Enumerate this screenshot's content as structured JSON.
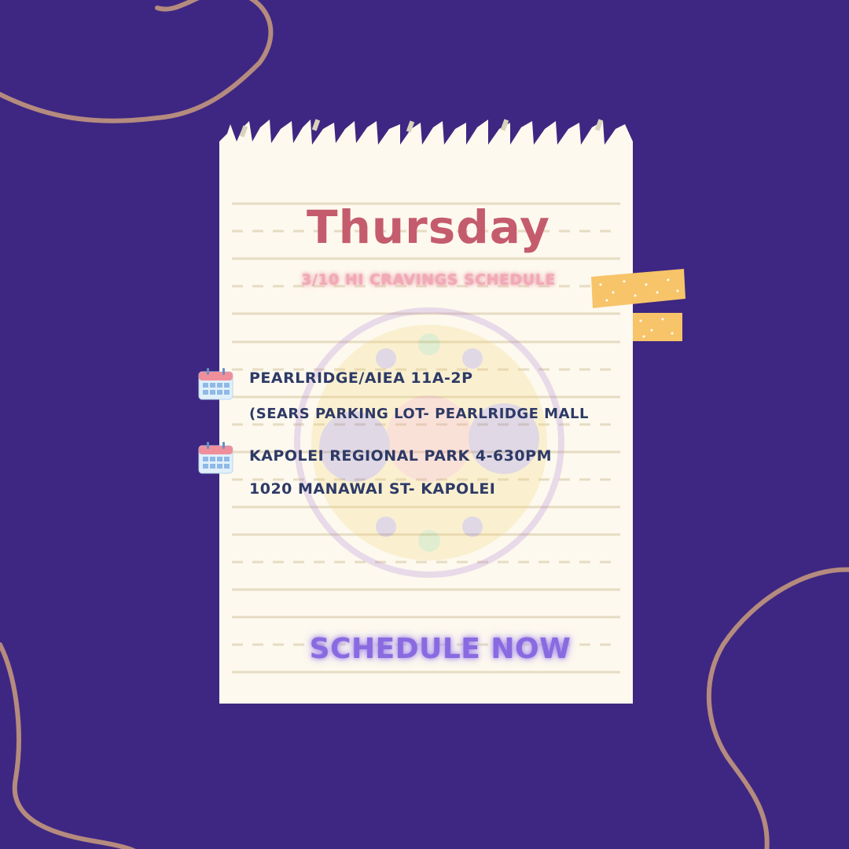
{
  "poster": {
    "day": "Thursday",
    "subtitle": "3/10 HI CRAVINGS SCHEDULE",
    "entries": [
      {
        "line1": "PEARLRIDGE/AIEA 11A-2P",
        "line2": "(SEARS PARKING LOT- PEARLRIDGE MALL",
        "icon": "calendar-icon"
      },
      {
        "line1": "KAPOLEI REGIONAL PARK 4-630PM",
        "line2": "1020 MANAWAI ST- KAPOLEI",
        "icon": "calendar-icon"
      }
    ],
    "cta": "SCHEDULE NOW"
  },
  "colors": {
    "background": "#3e2782",
    "paper": "#fdf9ee",
    "title": "#c45c6e",
    "subtitle_glow": "#f2a8b5",
    "entry_text": "#2e3a66",
    "cta": "#8a6ae0",
    "tape": "#f7c46a",
    "squiggle": "#b48b7e"
  }
}
